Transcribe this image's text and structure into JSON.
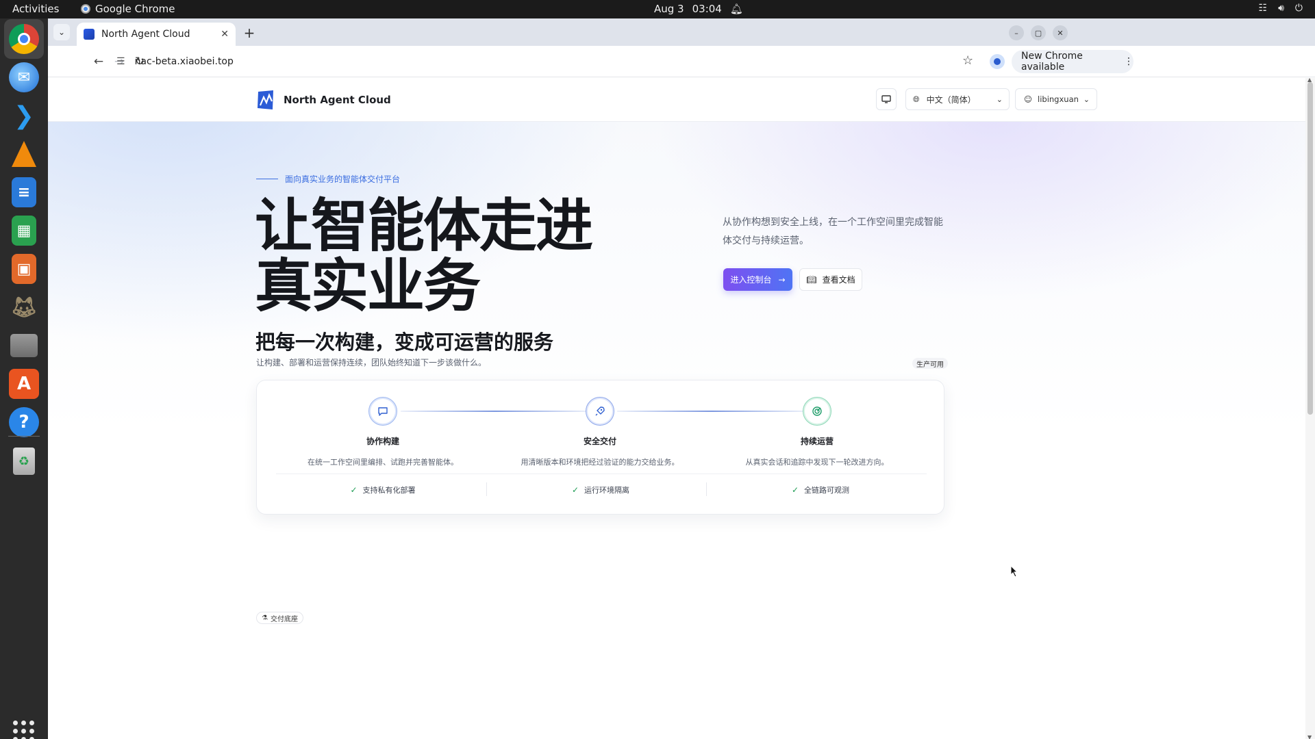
{
  "system_bar": {
    "activities": "Activities",
    "app_name": "Google Chrome",
    "date": "Aug 3",
    "time": "03:04"
  },
  "dock": {
    "apps": [
      "chrome-icon",
      "thunderbird-icon",
      "vscode-icon",
      "vlc-icon",
      "writer-icon",
      "calc-icon",
      "impress-icon",
      "gimp-icon",
      "files-icon",
      "app-center-icon",
      "help-icon",
      "trash-icon"
    ]
  },
  "browser": {
    "tab_title": "North Agent Cloud",
    "url": "nac-beta.xiaobei.top",
    "update_label": "New Chrome available"
  },
  "header": {
    "brand": "North Agent Cloud",
    "language": "中文（简体）",
    "user": "libingxuan"
  },
  "hero": {
    "eyebrow": "面向真实业务的智能体交付平台",
    "title_line1": "让智能体走进",
    "title_line2": "真实业务",
    "description": "从协作构想到安全上线，在一个工作空间里完成智能体交付与持续运营。",
    "primary_cta": "进入控制台",
    "secondary_cta": "查看文档"
  },
  "section": {
    "title": "把每一次构建，变成可运营的服务",
    "subtitle": "让构建、部署和运营保持连续，团队始终知道下一步该做什么。",
    "badge": "生产可用",
    "steps": [
      {
        "title": "协作构建",
        "desc": "在统一工作空间里编排、试跑并完善智能体。"
      },
      {
        "title": "安全交付",
        "desc": "用清晰版本和环境把经过验证的能力交给业务。"
      },
      {
        "title": "持续运营",
        "desc": "从真实会话和追踪中发现下一轮改进方向。"
      }
    ],
    "features": [
      "支持私有化部署",
      "运行环境隔离",
      "全链路可观测"
    ]
  },
  "footer_chip": "交付底座",
  "colors": {
    "accent_start": "#7d4ff0",
    "accent_end": "#4f74f4",
    "eyebrow": "#3a6de0",
    "step1_ring": "#9fb8f0",
    "step2_ring": "#8fa8ea",
    "step3_ring": "#8fd8b8"
  }
}
